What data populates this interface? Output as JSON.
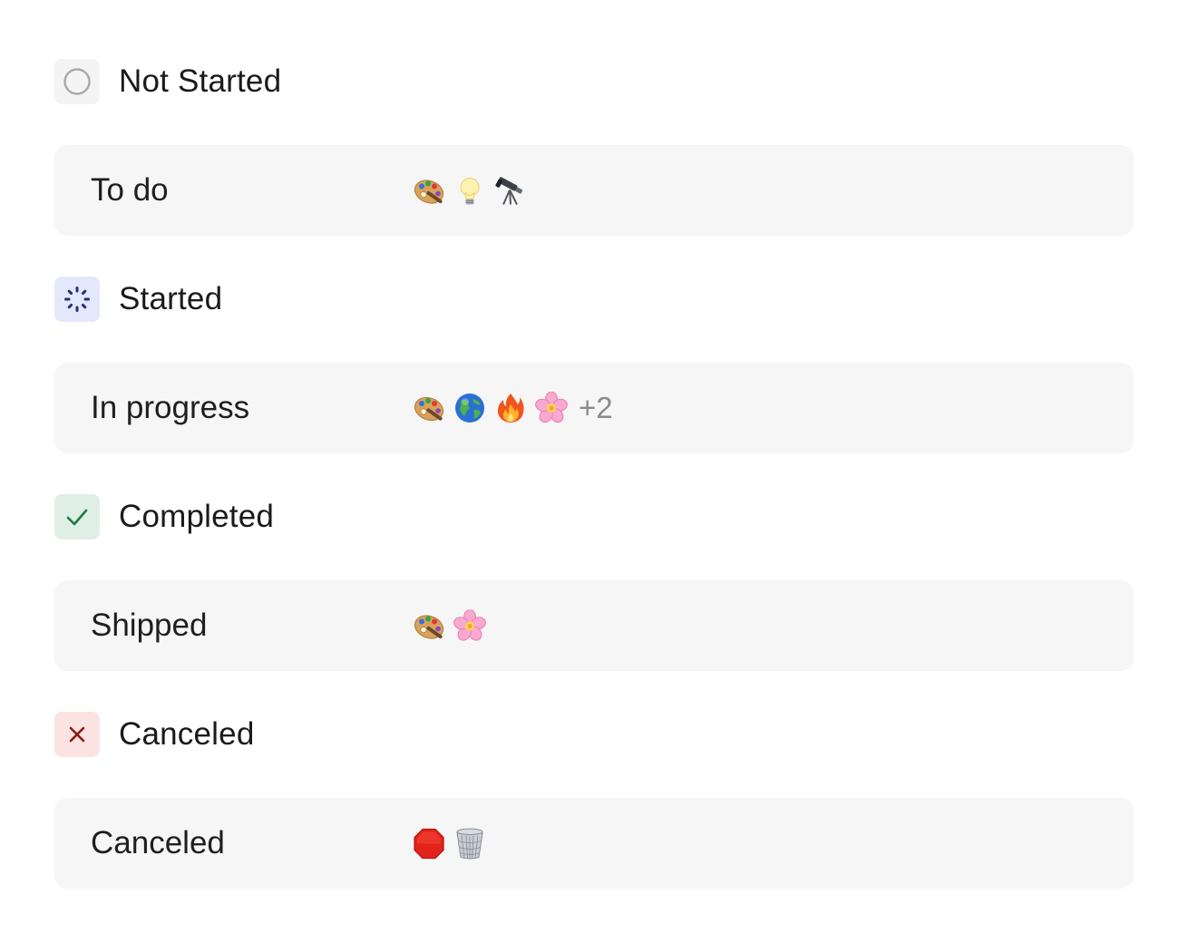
{
  "groups": [
    {
      "title": "Not Started",
      "icon": "empty-circle-icon",
      "rows": [
        {
          "label": "To do",
          "emojis": [
            "palette-emoji",
            "light-bulb-emoji",
            "telescope-emoji"
          ],
          "more": ""
        }
      ]
    },
    {
      "title": "Started",
      "icon": "spinner-icon",
      "rows": [
        {
          "label": "In progress",
          "emojis": [
            "palette-emoji",
            "globe-emoji",
            "fire-emoji",
            "cherry-blossom-emoji"
          ],
          "more": "+2"
        }
      ]
    },
    {
      "title": "Completed",
      "icon": "checkmark-icon",
      "rows": [
        {
          "label": "Shipped",
          "emojis": [
            "palette-emoji",
            "cherry-blossom-emoji"
          ],
          "more": ""
        }
      ]
    },
    {
      "title": "Canceled",
      "icon": "x-icon",
      "rows": [
        {
          "label": "Canceled",
          "emojis": [
            "stop-sign-emoji",
            "wastebasket-emoji"
          ],
          "more": ""
        }
      ]
    }
  ],
  "colors": {
    "not_started_bg": "#f4f4f4",
    "started_bg": "#e4e8fb",
    "started_accent": "#26307a",
    "completed_bg": "#e0efe5",
    "completed_accent": "#1f7a3c",
    "canceled_bg": "#fbe3e1",
    "canceled_accent": "#8a1a17",
    "row_bg": "#f6f6f6"
  }
}
